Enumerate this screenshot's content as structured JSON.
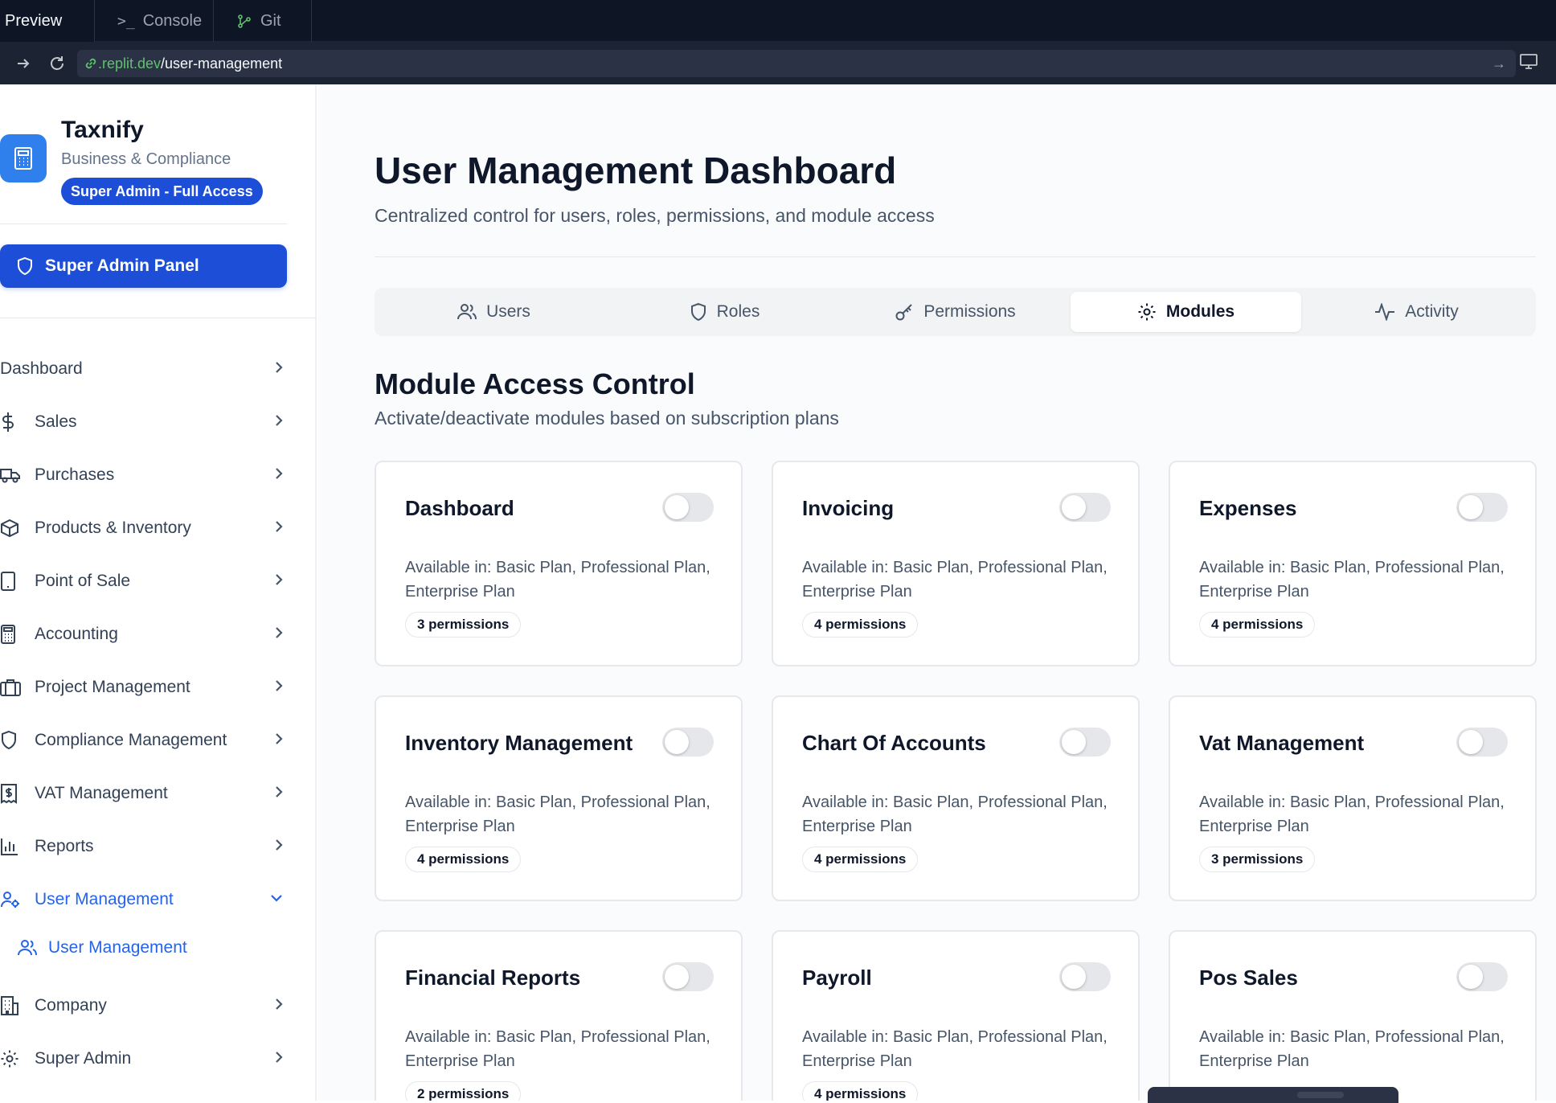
{
  "browser": {
    "tabs": [
      {
        "label": "Preview",
        "icon": "preview",
        "active": true
      },
      {
        "label": "Console",
        "icon": "console-icon",
        "glyph": ">_"
      },
      {
        "label": "Git",
        "icon": "git-icon"
      }
    ],
    "url_domain": ".replit.dev",
    "url_path": "/user-management"
  },
  "sidebar": {
    "brand_name": "Taxnify",
    "brand_sub": "Business & Compliance",
    "badge": "Super Admin - Full Access",
    "admin_panel_label": "Super Admin Panel",
    "items": [
      {
        "label": "Dashboard",
        "icon": "none"
      },
      {
        "label": "Sales",
        "icon": "dollar-icon"
      },
      {
        "label": "Purchases",
        "icon": "truck-icon"
      },
      {
        "label": "Products & Inventory",
        "icon": "box-icon"
      },
      {
        "label": "Point of Sale",
        "icon": "tablet-icon"
      },
      {
        "label": "Accounting",
        "icon": "calculator-icon"
      },
      {
        "label": "Project Management",
        "icon": "briefcase-icon"
      },
      {
        "label": "Compliance Management",
        "icon": "shield-icon"
      },
      {
        "label": "VAT Management",
        "icon": "receipt-icon"
      },
      {
        "label": "Reports",
        "icon": "bar-chart-icon"
      },
      {
        "label": "User Management",
        "icon": "user-cog-icon",
        "active": true
      },
      {
        "label": "Company",
        "icon": "building-icon"
      },
      {
        "label": "Super Admin",
        "icon": "gear-icon"
      }
    ],
    "sub_item": "User Management"
  },
  "main": {
    "title": "User Management Dashboard",
    "subtitle": "Centralized control for users, roles, permissions, and module access",
    "tabs": [
      {
        "label": "Users",
        "icon": "users-icon"
      },
      {
        "label": "Roles",
        "icon": "shield-icon"
      },
      {
        "label": "Permissions",
        "icon": "key-icon"
      },
      {
        "label": "Modules",
        "icon": "gear-icon",
        "active": true
      },
      {
        "label": "Activity",
        "icon": "activity-icon"
      }
    ],
    "section_title": "Module Access Control",
    "section_subtitle": "Activate/deactivate modules based on subscription plans",
    "modules": [
      {
        "name": "Dashboard",
        "available": "Available in: Basic Plan, Professional Plan, Enterprise Plan",
        "permissions": "3 permissions",
        "enabled": false
      },
      {
        "name": "Invoicing",
        "available": "Available in: Basic Plan, Professional Plan, Enterprise Plan",
        "permissions": "4 permissions",
        "enabled": false
      },
      {
        "name": "Expenses",
        "available": "Available in: Basic Plan, Professional Plan, Enterprise Plan",
        "permissions": "4 permissions",
        "enabled": false
      },
      {
        "name": "Inventory Management",
        "available": "Available in: Basic Plan, Professional Plan, Enterprise Plan",
        "permissions": "4 permissions",
        "enabled": false
      },
      {
        "name": "Chart Of Accounts",
        "available": "Available in: Basic Plan, Professional Plan, Enterprise Plan",
        "permissions": "4 permissions",
        "enabled": false
      },
      {
        "name": "Vat Management",
        "available": "Available in: Basic Plan, Professional Plan, Enterprise Plan",
        "permissions": "3 permissions",
        "enabled": false
      },
      {
        "name": "Financial Reports",
        "available": "Available in: Basic Plan, Professional Plan, Enterprise Plan",
        "permissions": "2 permissions",
        "enabled": false
      },
      {
        "name": "Payroll",
        "available": "Available in: Basic Plan, Professional Plan, Enterprise Plan",
        "permissions": "4 permissions",
        "enabled": false
      },
      {
        "name": "Pos Sales",
        "available": "Available in: Basic Plan, Professional Plan, Enterprise Plan",
        "permissions": "",
        "enabled": false
      }
    ]
  },
  "colors": {
    "accent": "#1d4ed8",
    "active_nav": "#2563eb",
    "chrome_bg": "#0e1525"
  }
}
